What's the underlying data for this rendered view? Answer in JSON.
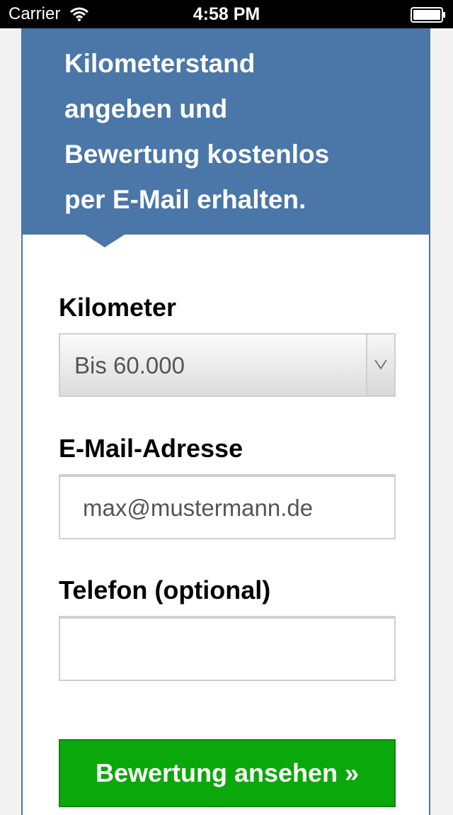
{
  "status_bar": {
    "carrier": "Carrier",
    "time": "4:58 PM",
    "wifi_icon": "wifi-icon",
    "battery_icon": "battery-icon"
  },
  "banner": {
    "lines": [
      "Kilometerstand",
      "angeben und",
      "Bewertung kostenlos",
      "per E-Mail erhalten."
    ]
  },
  "form": {
    "kilometer_label": "Kilometer",
    "kilometer_selected": "Bis 60.000",
    "email_label": "E-Mail-Adresse",
    "email_placeholder": "max@mustermann.de",
    "phone_label": "Telefon (optional)",
    "phone_value": "",
    "submit_label": "Bewertung ansehen »"
  },
  "colors": {
    "banner_blue": "#4a76a8",
    "button_green": "#0aa80a",
    "page_background": "#f2f2f2"
  }
}
